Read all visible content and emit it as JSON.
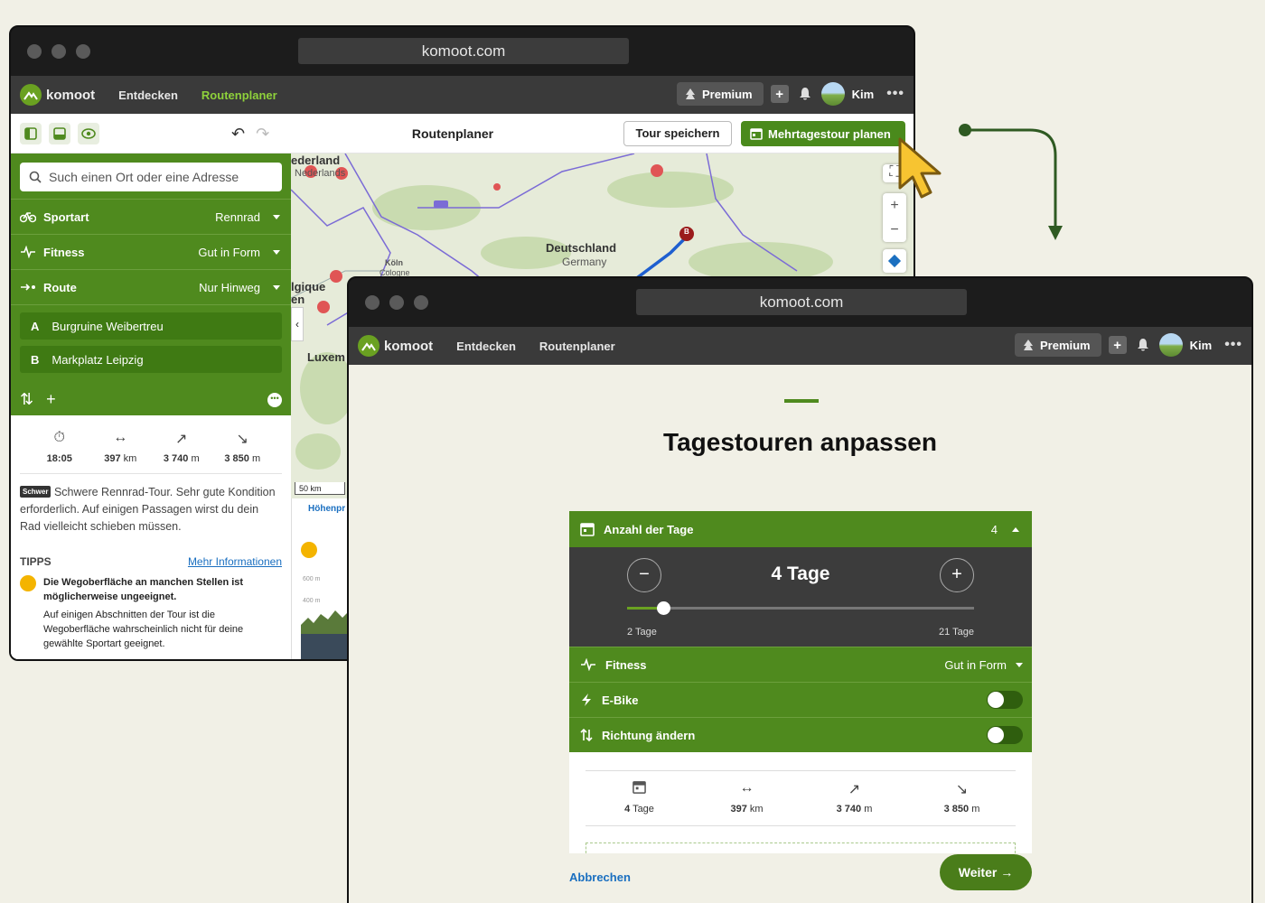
{
  "window1": {
    "url": "komoot.com",
    "nav": {
      "brand": "komoot",
      "links": [
        "Entdecken",
        "Routenplaner"
      ],
      "premium": "Premium",
      "user": "Kim"
    },
    "toolbar": {
      "title": "Routenplaner",
      "save_label": "Tour speichern",
      "multiday_label": "Mehrtagestour planen"
    },
    "sidebar": {
      "search_placeholder": "Such einen Ort oder eine Adresse",
      "rows": [
        {
          "label": "Sportart",
          "value": "Rennrad",
          "icon": "bike-icon"
        },
        {
          "label": "Fitness",
          "value": "Gut in Form",
          "icon": "pulse-icon"
        },
        {
          "label": "Route",
          "value": "Nur Hinweg",
          "icon": "route-icon"
        }
      ],
      "waypoints": [
        {
          "letter": "A",
          "name": "Burgruine Weibertreu"
        },
        {
          "letter": "B",
          "name": "Markplatz Leipzig"
        }
      ],
      "stats": [
        {
          "icon": "timer-icon",
          "value": "18:05",
          "unit": ""
        },
        {
          "icon": "distance-icon",
          "value": "397",
          "unit": "km"
        },
        {
          "icon": "uphill-icon",
          "value": "3 740",
          "unit": "m"
        },
        {
          "icon": "downhill-icon",
          "value": "3 850",
          "unit": "m"
        }
      ],
      "difficulty_tag": "Schwer",
      "description": "Schwere Rennrad-Tour. Sehr gute Kondition erforderlich. Auf einigen Passagen wirst du dein Rad vielleicht schieben müssen.",
      "tips_heading": "TIPPS",
      "more_info": "Mehr Informationen",
      "tip_title": "Die Wegoberfläche an manchen Stellen ist möglicherweise ungeeignet.",
      "tip_text": "Auf einigen Abschnitten der Tour ist die Wegoberfläche wahrscheinlich nicht für deine gewählte Sportart geeignet."
    },
    "map": {
      "labels": [
        "ederland",
        "Nederlands",
        "Deutschland",
        "Germany",
        "Köln",
        "Cologne",
        "lgique",
        "en",
        "Luxem"
      ],
      "scale": "50 km",
      "profile_tab": "Höhenpr",
      "profile_ticks": [
        "600 m",
        "400 m"
      ],
      "marker_b": "B"
    }
  },
  "window2": {
    "url": "komoot.com",
    "nav": {
      "brand": "komoot",
      "links": [
        "Entdecken",
        "Routenplaner"
      ],
      "premium": "Premium",
      "user": "Kim"
    },
    "title": "Tagestouren anpassen",
    "days": {
      "label": "Anzahl der Tage",
      "count": "4",
      "display": "4 Tage",
      "min_label": "2 Tage",
      "max_label": "21 Tage",
      "min": 2,
      "max": 21,
      "value": 4
    },
    "rows": [
      {
        "label": "Fitness",
        "value": "Gut in Form",
        "icon": "pulse-icon"
      },
      {
        "label": "E-Bike",
        "toggle": false,
        "icon": "bolt-icon"
      },
      {
        "label": "Richtung ändern",
        "toggle": false,
        "icon": "swap-icon"
      }
    ],
    "stats": [
      {
        "icon": "calendar-icon",
        "value": "4",
        "unit": "Tage"
      },
      {
        "icon": "distance-icon",
        "value": "397",
        "unit": "km"
      },
      {
        "icon": "uphill-icon",
        "value": "3 740",
        "unit": "m"
      },
      {
        "icon": "downhill-icon",
        "value": "3 850",
        "unit": "m"
      }
    ],
    "cancel_label": "Abbrechen",
    "next_label": "Weiter →"
  },
  "colors": {
    "brand_green": "#4f8a1e",
    "active_nav": "#8ed13b",
    "link_blue": "#1a6fc0",
    "background": "#f1f0e6"
  }
}
